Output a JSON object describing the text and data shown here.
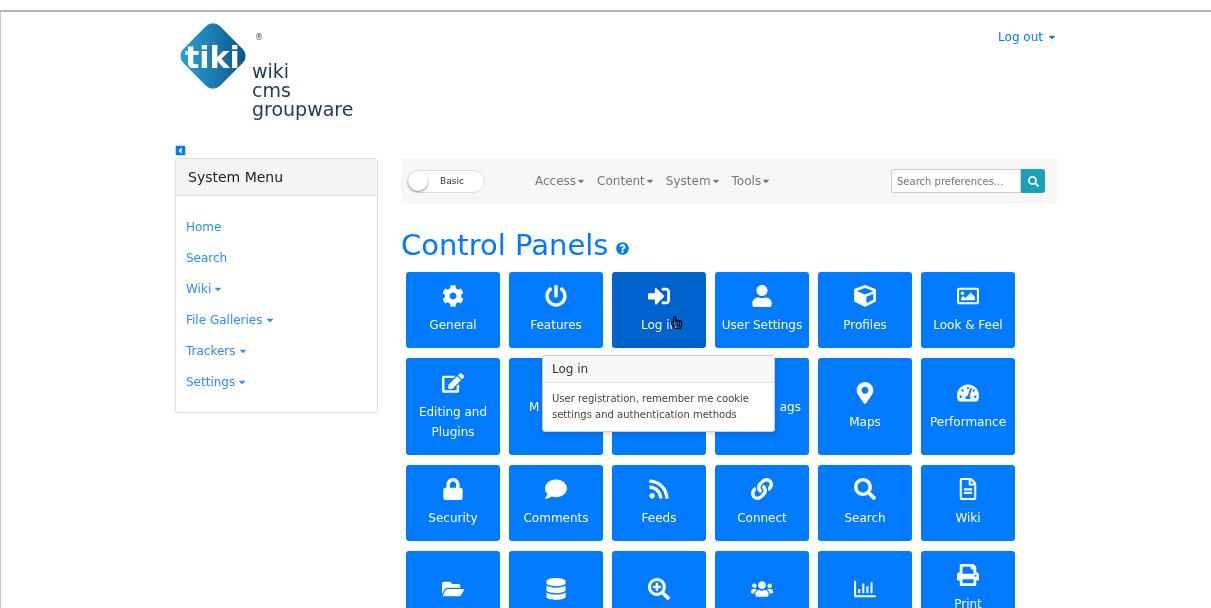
{
  "logo": {
    "mark": "tiki",
    "registered": "®",
    "lines": [
      "wiki",
      "cms",
      "groupware"
    ]
  },
  "user_menu": {
    "label": "Log out"
  },
  "sidebar": {
    "title": "System Menu",
    "items": [
      {
        "label": "Home",
        "dropdown": false
      },
      {
        "label": "Search",
        "dropdown": false
      },
      {
        "label": "Wiki",
        "dropdown": true
      },
      {
        "label": "File Galleries",
        "dropdown": true
      },
      {
        "label": "Trackers",
        "dropdown": true
      },
      {
        "label": "Settings",
        "dropdown": true
      }
    ]
  },
  "toolbar": {
    "mode_toggle": {
      "label": "Basic",
      "on": false
    },
    "menus": [
      "Access",
      "Content",
      "System",
      "Tools"
    ],
    "search": {
      "placeholder": "Search preferences..."
    }
  },
  "title": "Control Panels",
  "tiles": [
    {
      "label": "General",
      "selected": false
    },
    {
      "label": "Features",
      "selected": false
    },
    {
      "label": "Log in",
      "selected": true
    },
    {
      "label": "User Settings",
      "selected": false
    },
    {
      "label": "Profiles",
      "selected": false
    },
    {
      "label": "Look & Feel",
      "selected": false
    },
    {
      "label": "Editing and Plugins",
      "selected": false
    },
    {
      "label": "M",
      "kind": "covered",
      "selected": false
    },
    {
      "kind": "covered",
      "selected": false
    },
    {
      "label": "ags",
      "kind": "covered",
      "selected": false
    },
    {
      "label": "Maps",
      "selected": false
    },
    {
      "label": "Performance",
      "selected": false
    },
    {
      "label": "Security",
      "selected": false
    },
    {
      "label": "Comments",
      "selected": false
    },
    {
      "label": "Feeds",
      "selected": false
    },
    {
      "label": "Connect",
      "selected": false
    },
    {
      "label": "Search",
      "selected": false
    },
    {
      "label": "Wiki",
      "selected": false
    },
    {
      "selected": false
    },
    {
      "selected": false
    },
    {
      "selected": false
    },
    {
      "selected": false
    },
    {
      "selected": false
    },
    {
      "label": "Print",
      "selected": false
    }
  ],
  "popover": {
    "title": "Log in",
    "text": "User registration, remember me cookie settings and authentication methods"
  }
}
